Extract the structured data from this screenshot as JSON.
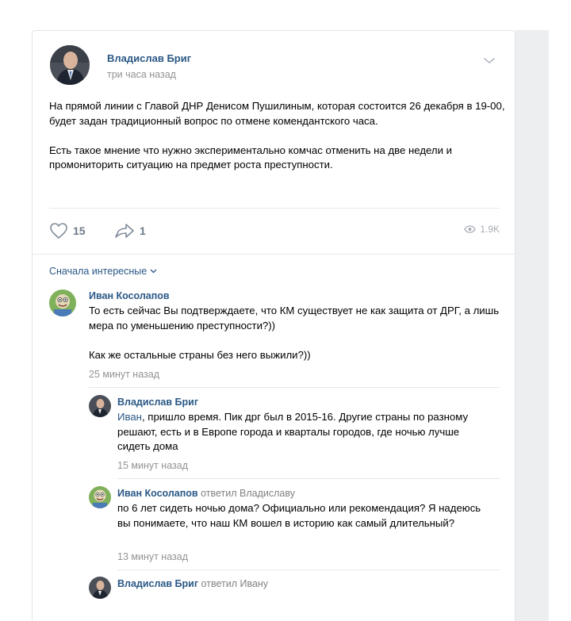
{
  "post": {
    "author": "Владислав Бриг",
    "time": "три часа назад",
    "paragraphs": [
      "На прямой линии с Главой ДНР Денисом Пушилиным, которая состоится 26 декабря в 19-00, будет задан традиционный вопрос по отмене комендантского часа.",
      "Есть такое мнение что нужно экспериментально комчас отменить на две недели и промониторить ситуацию на предмет роста преступности."
    ],
    "likes": "15",
    "shares": "1",
    "views": "1.9K"
  },
  "comments_sort": "Сначала интересные",
  "comments": [
    {
      "author": "Иван Косолапов",
      "paragraphs": [
        "То есть сейчас Вы подтверждаете, что КМ существует не как защита от ДРГ, а лишь мера по уменьшению преступности?))",
        "Как же остальные страны без него выжили?))"
      ],
      "time": "25 минут назад"
    },
    {
      "author": "Владислав Бриг",
      "mention": "Иван",
      "text": ", пришло время. Пик дрг был в 2015-16. Другие страны по разному решают, есть и в Европе города и кварталы городов, где ночью лучше сидеть дома",
      "time": "15 минут назад"
    },
    {
      "author": "Иван Косолапов",
      "replied": "ответил Владиславу",
      "text": "по 6 лет сидеть ночью дома? Официально или рекомендация? Я надеюсь вы понимаете, что наш КМ вошел в историю как самый длительный?",
      "time": "13 минут назад"
    },
    {
      "author": "Владислав Бриг",
      "replied": "ответил Ивану"
    }
  ],
  "colors": {
    "link": "#2a5885",
    "meta": "#939393",
    "divider": "#e7e8ec",
    "side_strip": "#edeef0",
    "action_icon": "#6e7b8a"
  },
  "icons": [
    "chevron-down-icon",
    "heart-icon",
    "share-arrow-icon",
    "eye-icon",
    "sort-chevron-icon"
  ]
}
